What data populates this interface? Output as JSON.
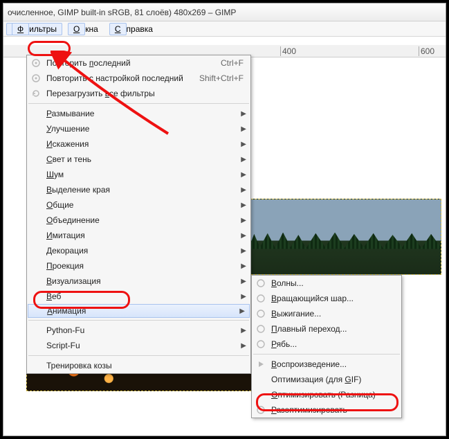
{
  "title": "очисленное, GIMP built-in sRGB, 81 слоёв) 480x269 – GIMP",
  "menubar": {
    "filters": "Фильтры",
    "windows": "Окна",
    "help": "Справка"
  },
  "ruler": {
    "t400": "400",
    "t600": "600"
  },
  "m1": {
    "repeat": "Повторить последний",
    "repeat_sc": "Ctrl+F",
    "reshow": "Повторить с настройкой последний",
    "reshow_sc": "Shift+Ctrl+F",
    "reset": "Перезагрузить все фильтры",
    "blur": "Размывание",
    "enhance": "Улучшение",
    "distort": "Искажения",
    "light": "Свет и тень",
    "noise": "Шум",
    "edge": "Выделение края",
    "generic": "Общие",
    "combine": "Объединение",
    "artistic": "Имитация",
    "decor": "Декорация",
    "map": "Проекция",
    "render": "Визуализация",
    "web": "Веб",
    "anim": "Анимация",
    "python": "Python-Fu",
    "script": "Script-Fu",
    "goat": "Тренировка козы"
  },
  "m2": {
    "waves": "Волны...",
    "globe": "Вращающийся шар...",
    "burn": "Выжигание...",
    "blend": "Плавный переход...",
    "ripple": "Рябь...",
    "play": "Воспроизведение...",
    "optgif": "Оптимизация (для GIF)",
    "optdiff": "Оптимизировать (Разница)",
    "unopt": "Разоптимизировать"
  },
  "underline": {
    "filters": "Ф",
    "windows": "О",
    "help": "С",
    "repeat_u": "п",
    "reset_u": "в",
    "size_u": "Р",
    "enhance_u": "У",
    "distort_u": "И",
    "light_u": "С",
    "noise_u": "Ш",
    "edge_u": "В",
    "generic_u": "О",
    "combine_u": "О",
    "artistic_u": "И",
    "decor_u": "Д",
    "map_u": "П",
    "render_u": "В",
    "web_u": "В",
    "anim_u": "А",
    "waves_u": "В",
    "globe_u": "В",
    "burn_u": "В",
    "blend_u": "П",
    "ripple_u": "Р",
    "play_u": "В",
    "optgif_u": "G",
    "optdiff_u": "О",
    "unopt_u": "Р"
  }
}
